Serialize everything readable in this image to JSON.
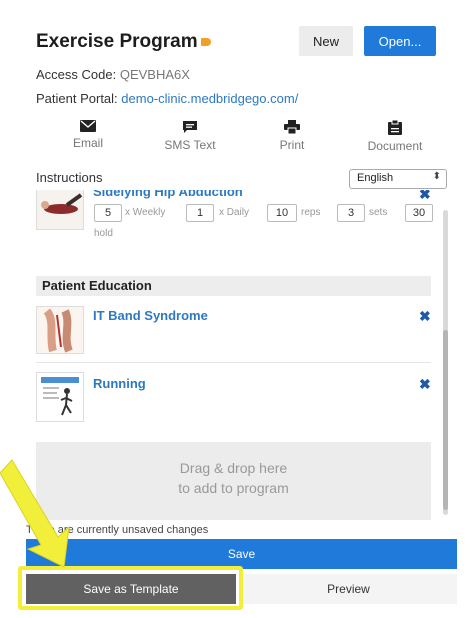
{
  "header": {
    "title": "Exercise Program",
    "new_label": "New",
    "open_label": "Open..."
  },
  "access": {
    "label": "Access Code: ",
    "code": "QEVBHA6X"
  },
  "portal": {
    "label": "Patient Portal: ",
    "link": "demo-clinic.medbridgego.com/"
  },
  "share": {
    "email": "Email",
    "sms": "SMS Text",
    "print": "Print",
    "document": "Document"
  },
  "instructions": {
    "label": "Instructions",
    "language": "English"
  },
  "exercise": {
    "name": "Sidelying Hip Abduction",
    "weekly_value": "5",
    "weekly_unit": "x Weekly",
    "daily_value": "1",
    "daily_unit": "x Daily",
    "reps_value": "10",
    "reps_unit": "reps",
    "sets_value": "3",
    "sets_unit": "sets",
    "hold_value": "30",
    "hold_unit": "hold"
  },
  "education": {
    "heading": "Patient Education",
    "items": [
      {
        "title": "IT Band Syndrome"
      },
      {
        "title": "Running"
      }
    ]
  },
  "dropzone": {
    "line1": "Drag & drop here",
    "line2": "to add to program"
  },
  "footer": {
    "unsaved": "There are currently unsaved changes",
    "save": "Save",
    "save_template": "Save as Template",
    "preview": "Preview"
  },
  "colors": {
    "primary": "#1f7ad9",
    "link": "#2d78c4",
    "highlight": "#f2ef3a",
    "tag": "#f0a029"
  }
}
